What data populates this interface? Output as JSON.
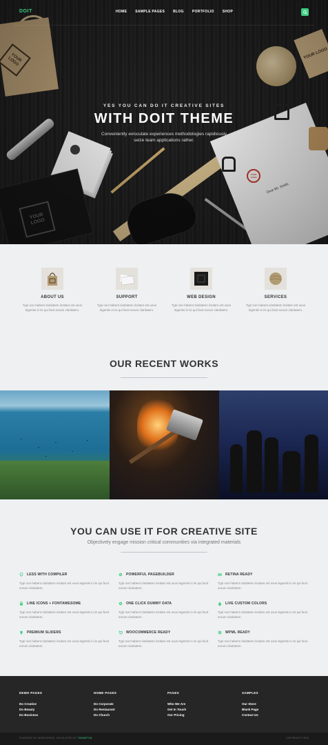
{
  "nav": {
    "logo": "DOIT",
    "menu": [
      "HOME",
      "SAMPLE PAGES",
      "BLOG",
      "PORTFOLIO",
      "SHOP"
    ],
    "accent": "#3ecf83"
  },
  "hero": {
    "subtitle": "YES YOU CAN DO IT CREATIVE SITES",
    "title": "WITH DOIT THEME",
    "description": "Conveniently evisculate experiences methodologies rapidiously seize team applications rather.",
    "bag_logo": "YOUR LOGO",
    "box_logo": "YOUR LOGO",
    "tag_logo": "YOUR LOGO",
    "seal_text": "YOUR LOGO",
    "letter_greeting": "Dear Mr. Smith,"
  },
  "features": [
    {
      "title": "ABOUT US",
      "text": "Typi non habent claritatem insitam est usus legentis in iis qui facit eorum claritatem.",
      "icon": "shopping-bag-icon"
    },
    {
      "title": "SUPPORT",
      "text": "Typi non habent claritatem insitam est usus legentis in iis qui facit eorum claritatem.",
      "icon": "business-cards-icon"
    },
    {
      "title": "WEB DESIGN",
      "text": "Typi non habent claritatem insitam est usus legentis in iis qui facit eorum claritatem.",
      "icon": "black-box-icon"
    },
    {
      "title": "SERVICES",
      "text": "Typi non habent claritatem insitam est usus legentis in iis qui facit eorum claritatem.",
      "icon": "twine-icon"
    }
  ],
  "works": {
    "title": "OUR RECENT WORKS"
  },
  "creative": {
    "title": "YOU CAN USE IT FOR CREATIVE SITE",
    "subtitle": "Objectively engage mission critical communities via integrated materials",
    "items": [
      {
        "title": "LESS WITH COMPILER",
        "text": "Typi non habent claritatem insitam est usus legentis in iis qui facit eorum claritatem.",
        "icon": "pin-icon"
      },
      {
        "title": "POWERFUL PAGEBUILDER",
        "text": "Typi non habent claritatem insitam est usus legentis in iis qui facit eorum claritatem.",
        "icon": "gear-icon"
      },
      {
        "title": "RETINA READY",
        "text": "Typi non habent claritatem insitam est usus legentis in iis qui facit eorum claritatem.",
        "icon": "columns-icon"
      },
      {
        "title": "LINE ICONS + FONTAWESOME",
        "text": "Typi non habent claritatem insitam est usus legentis in iis qui facit eorum claritatem.",
        "icon": "lock-icon"
      },
      {
        "title": "ONE CLICK DUMMY DATA",
        "text": "Typi non habent claritatem insitam est usus legentis in iis qui facit eorum claritatem.",
        "icon": "gear-icon"
      },
      {
        "title": "LIVE CUSTOM COLORS",
        "text": "Typi non habent claritatem insitam est usus legentis in iis qui facit eorum claritatem.",
        "icon": "droplet-icon"
      },
      {
        "title": "PREMIUM SLIDERS",
        "text": "Typi non habent claritatem insitam est usus legentis in iis qui facit eorum claritatem.",
        "icon": "lightbulb-icon"
      },
      {
        "title": "WOOCOMMERCE READY",
        "text": "Typi non habent claritatem insitam est usus legentis in iis qui facit eorum claritatem.",
        "icon": "cart-icon"
      },
      {
        "title": "WPML READY",
        "text": "Typi non habent claritatem insitam est usus legentis in iis qui facit eorum claritatem.",
        "icon": "globe-icon"
      }
    ]
  },
  "footer": {
    "columns": [
      {
        "title": "DEMO PAGES",
        "links": [
          "Do Creative",
          "Do Beauty",
          "Do Business"
        ]
      },
      {
        "title": "HOME PAGES",
        "links": [
          "Do Corporate",
          "Do Restaurant",
          "Do Church"
        ]
      },
      {
        "title": "PAGES",
        "links": [
          "Who We Are",
          "Get In Touch",
          "Our Pricing"
        ]
      },
      {
        "title": "SAMPLES",
        "links": [
          "Our Store",
          "Blank Page",
          "Contact Us"
        ]
      }
    ],
    "powered": "POWERED BY WORDPRESS. DEVELOPED BY",
    "brand": "THEMETON",
    "copyright": "COPYRIGHT © 2015"
  }
}
